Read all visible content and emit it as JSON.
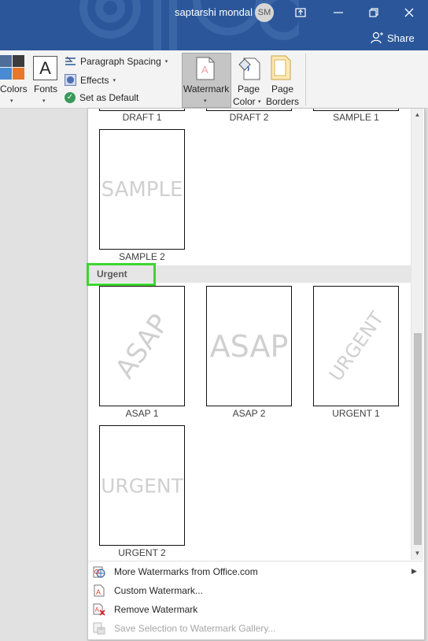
{
  "titlebar": {
    "user_name": "saptarshi mondal",
    "avatar_initials": "SM",
    "share_label": "Share",
    "color": "#2b579a"
  },
  "ribbon": {
    "colors_label": "Colors",
    "fonts_label": "Fonts",
    "fonts_glyph": "A",
    "paragraph_spacing_label": "Paragraph Spacing",
    "effects_label": "Effects",
    "set_default_label": "Set as Default",
    "watermark_label": "Watermark",
    "page_color_label_1": "Page",
    "page_color_label_2": "Color",
    "page_borders_label_1": "Page",
    "page_borders_label_2": "Borders"
  },
  "gallery": {
    "top_partial_captions": [
      "DRAFT 1",
      "DRAFT 2",
      "SAMPLE 1"
    ],
    "disclaimers_item": {
      "caption": "SAMPLE 2",
      "text": "SAMPLE"
    },
    "section_title": "Urgent",
    "urgent_items": [
      {
        "caption": "ASAP 1",
        "text": "ASAP",
        "style": "diagonal"
      },
      {
        "caption": "ASAP 2",
        "text": "ASAP",
        "style": "horizontal"
      },
      {
        "caption": "URGENT 1",
        "text": "URGENT",
        "style": "diagonal"
      },
      {
        "caption": "URGENT 2",
        "text": "URGENT",
        "style": "horizontal"
      }
    ]
  },
  "menu": {
    "more_watermarks": "More Watermarks from Office.com",
    "custom_watermark": "Custom Watermark...",
    "remove_watermark": "Remove Watermark",
    "save_selection": "Save Selection to Watermark Gallery..."
  },
  "icons": {
    "check": "✓",
    "caret": "▾",
    "scroll_up": "▲",
    "scroll_down": "▼",
    "submenu": "▶"
  },
  "colors": {
    "highlight": "#3dd62f",
    "ribbon": "#f3f3f3",
    "selected_button": "#c5c5c5"
  }
}
